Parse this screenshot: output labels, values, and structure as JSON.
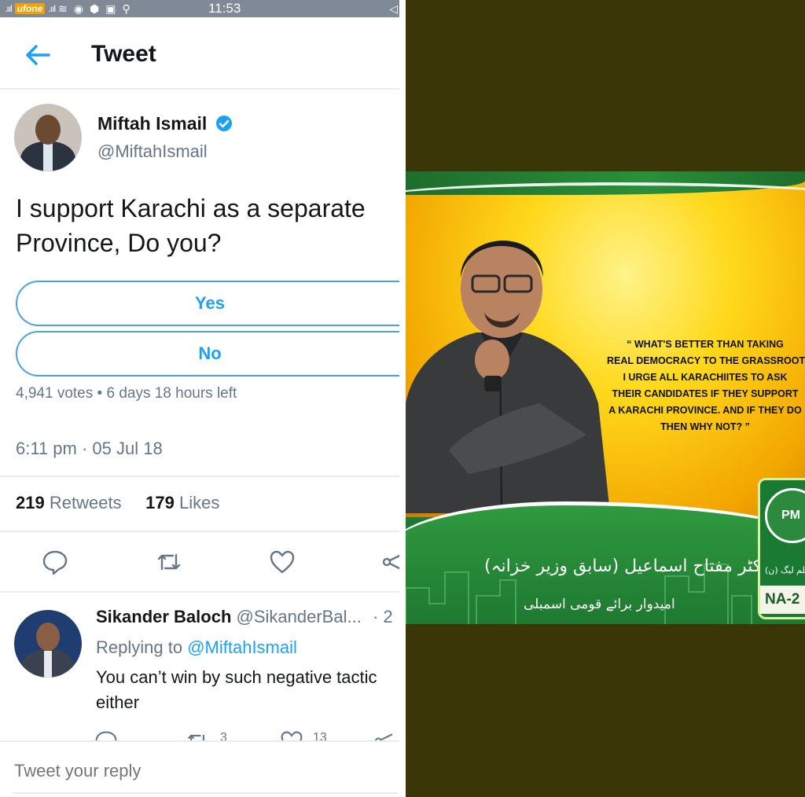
{
  "status_bar": {
    "carrier": "ufone",
    "time": "11:53"
  },
  "header": {
    "title": "Tweet"
  },
  "tweet": {
    "author_name": "Miftah Ismail",
    "author_handle": "@MiftahIsmail",
    "text_line1": "I support Karachi as a separate",
    "text_line2": "Province, Do you?",
    "poll": {
      "options": [
        "Yes",
        "No"
      ],
      "votes": "4,941 votes",
      "time_left": "6 days 18 hours left"
    },
    "timestamp": "6:11 pm · 05 Jul 18",
    "retweets_count": "219",
    "retweets_label": "Retweets",
    "likes_count": "179",
    "likes_label": "Likes"
  },
  "reply": {
    "name": "Sikander Baloch",
    "handle": "@SikanderBal...",
    "time": "· 2",
    "replying_prefix": "Replying to",
    "replying_to": "@MiftahIsmail",
    "text_line1": "You can’t win by such negative tactic",
    "text_line2": "either",
    "retweet_count": "3",
    "like_count": "13"
  },
  "reply_box": {
    "placeholder": "Tweet your reply"
  },
  "poster": {
    "quote_lines": [
      "“ WHAT'S BETTER THAN TAKING",
      "REAL DEMOCRACY TO THE GRASSROOTS",
      "I URGE ALL KARACHIITES TO ASK",
      "THEIR CANDIDATES IF THEY SUPPORT",
      "A KARACHI PROVINCE. AND IF THEY DO",
      "THEN WHY NOT? ”"
    ],
    "urdu_name": "(سابق وزیر خزانہ) ڈاکٹر مفتاح اسماعیل",
    "urdu_subtitle": "امیدوار برائے قومی اسمبلی",
    "party_abbrev": "PM",
    "party_urdu": "مسلم لیگ (ن)",
    "constituency": "NA-2"
  },
  "colors": {
    "twitter_blue": "#1da1f2",
    "text_dark": "#14171a",
    "text_gray": "#657786",
    "poster_green": "#1d7a34",
    "poster_yellow": "#ffd81a",
    "backdrop": "#3a3608"
  },
  "icons": [
    "back-arrow-icon",
    "verified-icon",
    "reply-icon",
    "retweet-icon",
    "like-icon",
    "share-icon"
  ]
}
